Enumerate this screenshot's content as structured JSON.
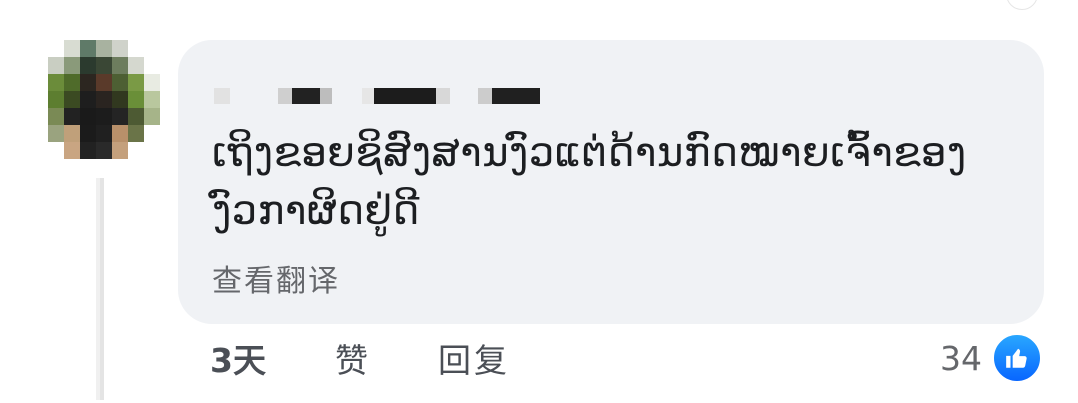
{
  "comment": {
    "author_name": "",
    "text": "ເຖິງຂອຍຊິສົງສານງົວແຕ່ດ້ານກົດໝາຍເຈົ້າຂອງງົວກາຜິດຢູ່ດີ",
    "see_translation": "查看翻译"
  },
  "actions": {
    "time": "3天",
    "like": "赞",
    "reply": "回复"
  },
  "reactions": {
    "count": "34",
    "icon": "thumbs-up-icon",
    "color": "#0866ff"
  },
  "colors": {
    "bubble": "#f0f2f5",
    "text": "#1c1e21",
    "secondary": "#65676b"
  }
}
